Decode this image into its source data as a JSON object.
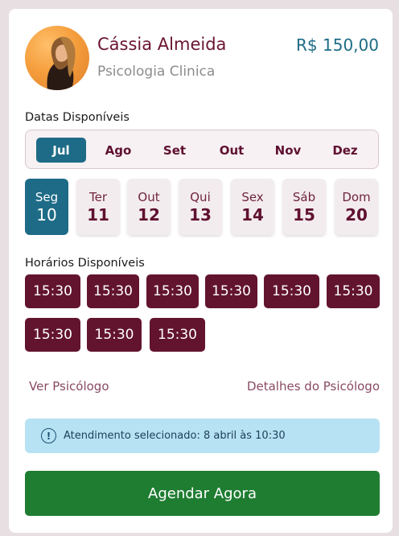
{
  "doctor": {
    "name": "Cássia Almeida",
    "specialty": "Psicologia Clinica",
    "price": "R$ 150,00"
  },
  "dates": {
    "title": "Datas Disponíveis",
    "months": [
      {
        "label": "Jul",
        "active": true
      },
      {
        "label": "Ago",
        "active": false
      },
      {
        "label": "Set",
        "active": false
      },
      {
        "label": "Out",
        "active": false
      },
      {
        "label": "Nov",
        "active": false
      },
      {
        "label": "Dez",
        "active": false
      }
    ],
    "days": [
      {
        "weekday": "Seg",
        "day": "10",
        "active": true
      },
      {
        "weekday": "Ter",
        "day": "11",
        "active": false
      },
      {
        "weekday": "Out",
        "day": "12",
        "active": false
      },
      {
        "weekday": "Qui",
        "day": "13",
        "active": false
      },
      {
        "weekday": "Sex",
        "day": "14",
        "active": false
      },
      {
        "weekday": "Sáb",
        "day": "15",
        "active": false
      },
      {
        "weekday": "Dom",
        "day": "20",
        "active": false
      }
    ]
  },
  "times": {
    "title": "Horários Disponíveis",
    "slots": [
      "15:30",
      "15:30",
      "15:30",
      "15:30",
      "15:30",
      "15:30",
      "15:30",
      "15:30",
      "15:30"
    ]
  },
  "links": {
    "view": "Ver Psicólogo",
    "details": "Detalhes do Psicólogo"
  },
  "alert": {
    "icon": "info-icon",
    "icon_glyph": "!",
    "text": "Atendimento selecionado: 8 abril às 10:30"
  },
  "cta": {
    "label": "Agendar Agora"
  },
  "colors": {
    "primary": "#1d6b86",
    "accent": "#62142f",
    "cta": "#1f7d32",
    "alert_bg": "#b7e2f3"
  }
}
